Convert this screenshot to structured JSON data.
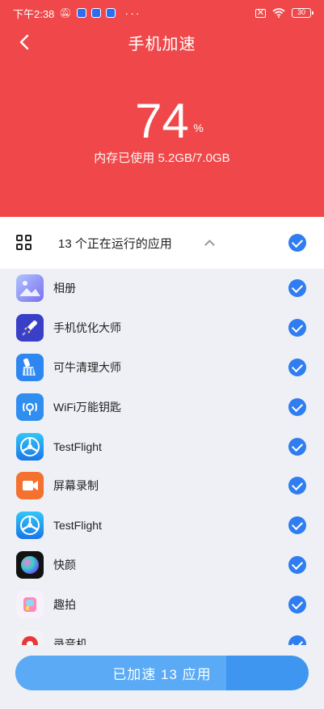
{
  "status_bar": {
    "time": "下午2:38",
    "battery": "30"
  },
  "nav": {
    "title": "手机加速"
  },
  "memory": {
    "percent": "74",
    "percent_sign": "%",
    "usage_text": "内存已使用 5.2GB/7.0GB"
  },
  "section": {
    "title": "13 个正在运行的应用"
  },
  "apps": [
    {
      "name": "相册",
      "icon": "gallery-icon",
      "color": "#8aa0f5"
    },
    {
      "name": "手机优化大师",
      "icon": "rocket-icon",
      "color": "#3b4fd8"
    },
    {
      "name": "可牛清理大师",
      "icon": "broom-icon",
      "color": "#2f8ef0"
    },
    {
      "name": "WiFi万能钥匙",
      "icon": "wifi-key-icon",
      "color": "#2f8ef0"
    },
    {
      "name": "TestFlight",
      "icon": "testflight-icon",
      "color": "#1fa6f2"
    },
    {
      "name": "屏幕录制",
      "icon": "video-icon",
      "color": "#f37132"
    },
    {
      "name": "TestFlight",
      "icon": "testflight-icon",
      "color": "#1fa6f2"
    },
    {
      "name": "快颜",
      "icon": "orb-icon",
      "color": "#111111"
    },
    {
      "name": "趣拍",
      "icon": "p-icon",
      "color": "#f6f0fb"
    },
    {
      "name": "录音机",
      "icon": "recorder-icon",
      "color": "#f5f5f5"
    }
  ],
  "cta": {
    "label": "已加速 13 应用",
    "progress": 0.72
  },
  "colors": {
    "header_red": "#f0484a",
    "accent_blue": "#2f7df0"
  }
}
